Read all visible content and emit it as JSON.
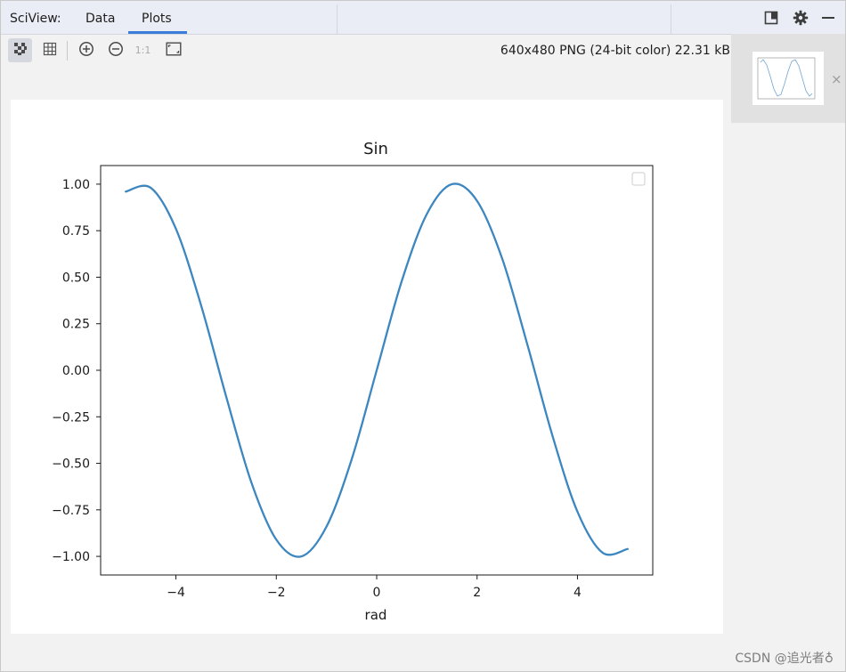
{
  "header": {
    "title": "SciView:",
    "tabs": [
      {
        "label": "Data"
      },
      {
        "label": "Plots"
      }
    ],
    "active_tab": "Plots"
  },
  "toolbar": {
    "buttons": [
      {
        "icon": "fit-checkerboard-icon",
        "active": true
      },
      {
        "icon": "grid-icon"
      },
      {
        "icon": "zoom-in-icon"
      },
      {
        "icon": "zoom-out-icon"
      },
      {
        "icon": "actual-size-icon",
        "label": "1:1"
      },
      {
        "icon": "fit-window-icon"
      }
    ]
  },
  "image_info": "640x480 PNG (24-bit color) 22.31 kB",
  "header_icons": [
    "layout-icon",
    "gear-icon",
    "minimize-icon"
  ],
  "thumbnail": {
    "close_label": "×"
  },
  "watermark": "CSDN @追光者♁",
  "colors": {
    "accent": "#3b7dd8",
    "line": "#3d87c0",
    "header_bg": "#eaedf5"
  },
  "chart_data": {
    "type": "line",
    "title": "Sin",
    "xlabel": "rad",
    "ylabel": "",
    "xlim": [
      -5.5,
      5.5
    ],
    "ylim": [
      -1.1,
      1.1
    ],
    "xticks": [
      -4,
      -2,
      0,
      2,
      4
    ],
    "xtick_labels": [
      "−4",
      "−2",
      "0",
      "2",
      "4"
    ],
    "yticks": [
      1.0,
      0.75,
      0.5,
      0.25,
      0.0,
      -0.25,
      -0.5,
      -0.75,
      -1.0
    ],
    "ytick_labels": [
      "1.00",
      "0.75",
      "0.50",
      "0.25",
      "0.00",
      "−0.25",
      "−0.50",
      "−0.75",
      "−1.00"
    ],
    "legend": "top-right, empty",
    "series": [
      {
        "x": [
          -5.0,
          -4.5,
          -4.0,
          -3.5,
          -3.0,
          -2.5,
          -2.0,
          -1.5,
          -1.0,
          -0.5,
          0.0,
          0.5,
          1.0,
          1.5,
          2.0,
          2.5,
          3.0,
          3.5,
          4.0,
          4.5,
          5.0
        ],
        "y": [
          0.96,
          0.98,
          0.76,
          0.35,
          -0.14,
          -0.6,
          -0.91,
          -1.0,
          -0.84,
          -0.48,
          0.0,
          0.48,
          0.84,
          1.0,
          0.91,
          0.6,
          0.14,
          -0.35,
          -0.76,
          -0.98,
          -0.96
        ]
      }
    ]
  }
}
